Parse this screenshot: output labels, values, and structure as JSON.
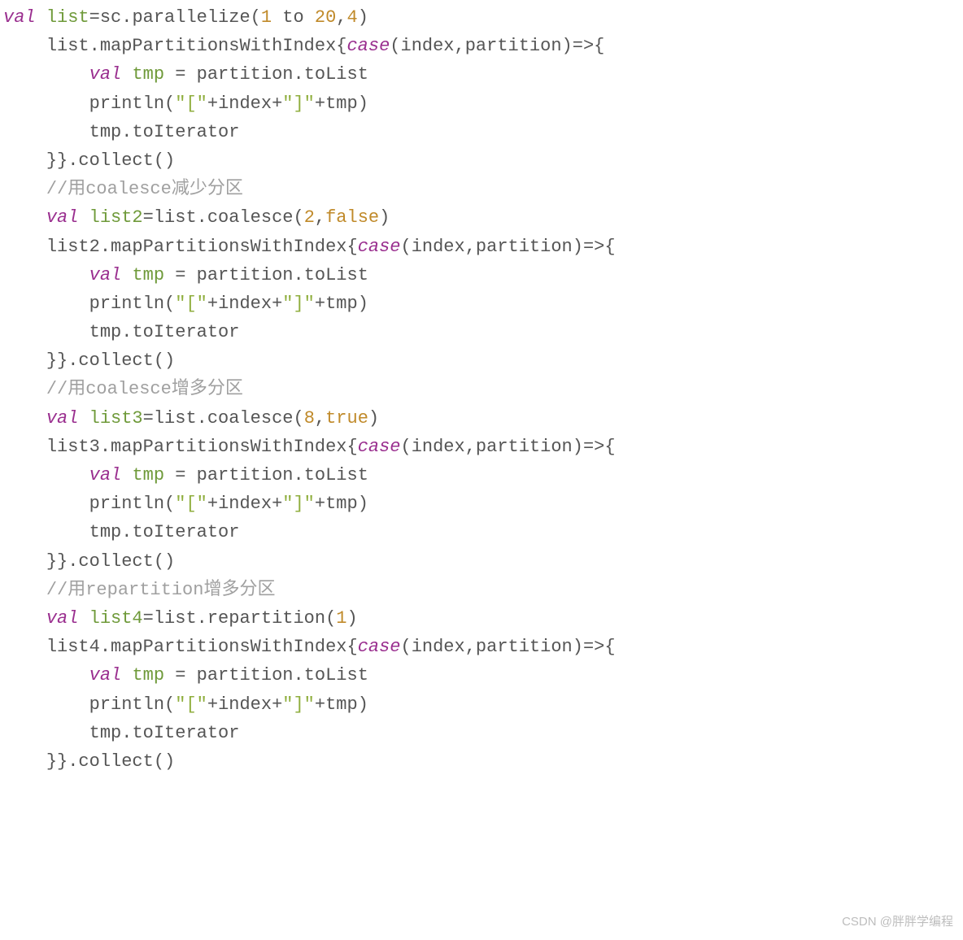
{
  "kw_val": "val",
  "kw_case": "case",
  "ident": {
    "list": "list",
    "list2": "list2",
    "list3": "list3",
    "list4": "list4",
    "tmp": "tmp",
    "sc": "sc",
    "index": "index",
    "partition": "partition"
  },
  "method": {
    "parallelize": "parallelize",
    "to": "to",
    "mapPartitionsWithIndex": "mapPartitionsWithIndex",
    "toList": "toList",
    "println": "println",
    "toIterator": "toIterator",
    "collect": "collect",
    "coalesce": "coalesce",
    "repartition": "repartition"
  },
  "num": {
    "n1": "1",
    "n20": "20",
    "n4": "4",
    "n2": "2",
    "n8": "8",
    "r1": "1"
  },
  "bool": {
    "false": "false",
    "true": "true"
  },
  "str": {
    "lb": "\"[\"",
    "rb": "\"]\""
  },
  "comment": {
    "c1": "//用coalesce减少分区",
    "c2": "//用coalesce增多分区",
    "c3": "//用repartition增多分区"
  },
  "punct": {
    "eq": "=",
    "dot": ".",
    "lp": "(",
    "rp": ")",
    "lb": "{",
    "rb": "}",
    "comma": ",",
    "arrow": "=>",
    "plus": "+",
    "sp": " ",
    "eqsp": " = "
  },
  "indent": {
    "i1": "    ",
    "i2": "        "
  },
  "watermark": "CSDN @胖胖学编程"
}
